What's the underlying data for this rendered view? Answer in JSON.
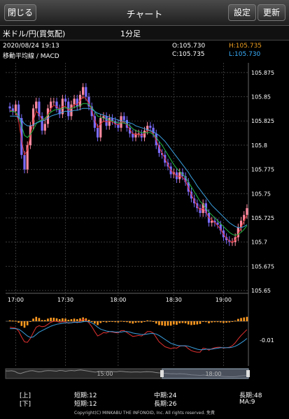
{
  "topbar": {
    "close_label": "閉じる",
    "title": "チャート",
    "settings_label": "設定",
    "refresh_label": "更新"
  },
  "instrument": {
    "name": "米ドル/円(買気配)",
    "timeframe": "1分足"
  },
  "info": {
    "datetime": "2020/08/24 19:13",
    "indicators": "移動平均線 / MACD",
    "open": "O:105.730",
    "high": "H:105.735",
    "close": "C:105.735",
    "low": "L:105.730"
  },
  "colors": {
    "bull": "#ff8aa0",
    "bear": "#7b6cff",
    "ma_short": "#e03030",
    "ma_mid": "#22bb44",
    "ma_long": "#3aa0e0",
    "high": "#f0a020",
    "low": "#3ab0ff",
    "hist": "#ff9a20"
  },
  "chart_data": {
    "type": "candlestick",
    "y_ticks": [
      "105.875",
      "105.85",
      "105.825",
      "105.8",
      "105.775",
      "105.75",
      "105.725",
      "105.7",
      "105.675",
      "105.65"
    ],
    "ylim": [
      105.65,
      105.885
    ],
    "x_ticks": [
      "17:00",
      "17:30",
      "18:00",
      "18:30",
      "19:00"
    ],
    "macd_label": "-0.01",
    "navigator_labels": [
      "15:00",
      "18:00"
    ],
    "candle_close": [
      105.838,
      105.835,
      105.842,
      105.828,
      105.79,
      105.775,
      105.8,
      105.82,
      105.838,
      105.845,
      105.83,
      105.815,
      105.822,
      105.838,
      105.845,
      105.845,
      105.838,
      105.832,
      105.848,
      105.845,
      105.83,
      105.842,
      105.848,
      105.84,
      105.852,
      105.86,
      105.85,
      105.84,
      105.83,
      105.818,
      105.808,
      105.828,
      105.83,
      105.82,
      105.828,
      105.825,
      105.822,
      105.818,
      105.83,
      105.826,
      105.818,
      105.812,
      105.808,
      105.812,
      105.812,
      105.808,
      105.815,
      105.82,
      105.818,
      105.812,
      105.8,
      105.792,
      105.79,
      105.782,
      105.778,
      105.77,
      105.772,
      105.765,
      105.772,
      105.768,
      105.762,
      105.752,
      105.745,
      105.74,
      105.735,
      105.73,
      105.74,
      105.73,
      105.72,
      105.722,
      105.72,
      105.718,
      105.712,
      105.705,
      105.702,
      105.7,
      105.7,
      105.705,
      105.715,
      105.722,
      105.728,
      105.735
    ],
    "ma_short": [
      105.836,
      105.835,
      105.834,
      105.825,
      105.805,
      105.79,
      105.795,
      105.81,
      105.825,
      105.835,
      105.832,
      105.826,
      105.826,
      105.832,
      105.838,
      105.841,
      105.84,
      105.837,
      105.84,
      105.84,
      105.836,
      105.838,
      105.842,
      105.842,
      105.846,
      105.85,
      105.848,
      105.843,
      105.836,
      105.826,
      105.818,
      105.822,
      105.825,
      105.824,
      105.825,
      105.824,
      105.822,
      105.821,
      105.824,
      105.824,
      105.821,
      105.816,
      105.812,
      105.811,
      105.811,
      105.81,
      105.812,
      105.815,
      105.815,
      105.812,
      105.805,
      105.798,
      105.792,
      105.786,
      105.78,
      105.774,
      105.771,
      105.768,
      105.768,
      105.767,
      105.763,
      105.756,
      105.749,
      105.743,
      105.737,
      105.733,
      105.735,
      105.731,
      105.725,
      105.723,
      105.72,
      105.717,
      105.713,
      105.708,
      105.704,
      105.701,
      105.7,
      105.702,
      105.708,
      105.715,
      105.722,
      105.728
    ],
    "ma_mid": [
      105.835,
      105.835,
      105.834,
      105.83,
      105.82,
      105.81,
      105.808,
      105.811,
      105.816,
      105.822,
      105.825,
      105.826,
      105.828,
      105.831,
      105.834,
      105.836,
      105.837,
      105.837,
      105.838,
      105.839,
      105.838,
      105.838,
      105.839,
      105.84,
      105.841,
      105.843,
      105.843,
      105.842,
      105.839,
      105.835,
      105.83,
      105.829,
      105.828,
      105.827,
      105.826,
      105.825,
      105.824,
      105.823,
      105.823,
      105.823,
      105.822,
      105.82,
      105.817,
      105.815,
      105.814,
      105.813,
      105.813,
      105.813,
      105.813,
      105.811,
      105.808,
      105.804,
      105.8,
      105.795,
      105.79,
      105.785,
      105.78,
      105.776,
      105.773,
      105.77,
      105.767,
      105.762,
      105.757,
      105.752,
      105.747,
      105.742,
      105.739,
      105.735,
      105.731,
      105.728,
      105.725,
      105.722,
      105.719,
      105.716,
      105.713,
      105.71,
      105.708,
      105.707,
      105.708,
      105.71,
      105.713,
      105.717
    ],
    "ma_long": [
      105.83,
      105.83,
      105.83,
      105.829,
      105.826,
      105.822,
      105.82,
      105.82,
      105.821,
      105.823,
      105.824,
      105.825,
      105.826,
      105.828,
      105.83,
      105.831,
      105.832,
      105.833,
      105.834,
      105.835,
      105.835,
      105.835,
      105.836,
      105.836,
      105.837,
      105.838,
      105.838,
      105.838,
      105.837,
      105.835,
      105.833,
      105.832,
      105.831,
      105.83,
      105.829,
      105.828,
      105.827,
      105.826,
      105.825,
      105.825,
      105.824,
      105.823,
      105.822,
      105.82,
      105.819,
      105.818,
      105.817,
      105.816,
      105.815,
      105.814,
      105.812,
      105.81,
      105.807,
      105.804,
      105.8,
      105.796,
      105.792,
      105.788,
      105.784,
      105.78,
      105.776,
      105.772,
      105.767,
      105.763,
      105.758,
      105.754,
      105.75,
      105.746,
      105.742,
      105.738,
      105.735,
      105.732,
      105.729,
      105.726,
      105.723,
      105.72,
      105.718,
      105.716,
      105.715,
      105.715,
      105.716,
      105.718
    ],
    "macd_hist": [
      0.3,
      0.2,
      0.1,
      -0.5,
      -1.6,
      -2.2,
      -1.4,
      -0.2,
      0.9,
      1.5,
      1.1,
      0.4,
      0.4,
      0.9,
      1.2,
      1.2,
      1.0,
      0.7,
      1.0,
      0.9,
      0.5,
      0.7,
      0.9,
      0.7,
      1.0,
      1.3,
      1.0,
      0.5,
      -0.1,
      -0.8,
      -1.3,
      -0.6,
      -0.2,
      -0.4,
      -0.1,
      -0.2,
      -0.3,
      -0.4,
      0.1,
      0.0,
      -0.3,
      -0.6,
      -0.8,
      -0.5,
      -0.4,
      -0.5,
      -0.1,
      0.3,
      0.2,
      -0.1,
      -0.8,
      -1.3,
      -1.4,
      -1.6,
      -1.5,
      -1.5,
      -1.1,
      -1.2,
      -0.7,
      -0.6,
      -0.7,
      -1.1,
      -1.3,
      -1.2,
      -1.1,
      -0.9,
      0.0,
      -0.3,
      -0.7,
      -0.4,
      -0.3,
      -0.3,
      -0.4,
      -0.6,
      -0.5,
      -0.4,
      -0.2,
      0.2,
      0.8,
      1.1,
      1.3,
      1.5
    ],
    "macd_line": [
      0.5,
      0.4,
      0.3,
      -0.3,
      -1.5,
      -2.5,
      -2.6,
      -1.8,
      -0.6,
      0.5,
      0.8,
      0.6,
      0.7,
      1.1,
      1.5,
      1.7,
      1.7,
      1.5,
      1.6,
      1.6,
      1.3,
      1.4,
      1.6,
      1.4,
      1.7,
      2.1,
      1.9,
      1.4,
      0.6,
      -0.4,
      -1.3,
      -1.0,
      -0.6,
      -0.7,
      -0.4,
      -0.5,
      -0.6,
      -0.7,
      -0.2,
      -0.2,
      -0.6,
      -1.0,
      -1.4,
      -1.3,
      -1.2,
      -1.3,
      -0.9,
      -0.4,
      -0.4,
      -0.7,
      -1.6,
      -2.5,
      -3.0,
      -3.5,
      -3.7,
      -3.9,
      -3.7,
      -3.8,
      -3.4,
      -3.3,
      -3.4,
      -3.9,
      -4.3,
      -4.5,
      -4.6,
      -4.6,
      -3.8,
      -3.9,
      -4.2,
      -3.9,
      -3.7,
      -3.6,
      -3.6,
      -3.8,
      -3.7,
      -3.6,
      -3.3,
      -2.7,
      -1.9,
      -1.2,
      -0.6,
      0.0
    ],
    "macd_signal": [
      0.2,
      0.2,
      0.2,
      0.1,
      -0.3,
      -0.8,
      -1.3,
      -1.6,
      -1.5,
      -1.0,
      -0.5,
      -0.2,
      0.1,
      0.4,
      0.7,
      0.9,
      1.1,
      1.2,
      1.3,
      1.4,
      1.4,
      1.4,
      1.5,
      1.5,
      1.5,
      1.6,
      1.7,
      1.6,
      1.4,
      1.0,
      0.5,
      0.1,
      -0.1,
      -0.3,
      -0.4,
      -0.4,
      -0.5,
      -0.5,
      -0.5,
      -0.4,
      -0.4,
      -0.5,
      -0.7,
      -0.8,
      -0.9,
      -1.0,
      -1.0,
      -0.9,
      -0.8,
      -0.8,
      -0.9,
      -1.2,
      -1.6,
      -2.0,
      -2.4,
      -2.8,
      -3.0,
      -3.2,
      -3.3,
      -3.3,
      -3.3,
      -3.4,
      -3.6,
      -3.8,
      -4.0,
      -4.1,
      -4.1,
      -4.0,
      -4.0,
      -4.0,
      -3.9,
      -3.8,
      -3.7,
      -3.7,
      -3.7,
      -3.7,
      -3.6,
      -3.4,
      -3.1,
      -2.7,
      -2.3,
      -1.8
    ]
  },
  "params": {
    "up_label": "[上]",
    "down_label": "[下]",
    "short_up": "短期:12",
    "mid_up": "中期:24",
    "long_up": "長期:48",
    "short_down": "短期:12",
    "long_down": "長期:26",
    "ma_down": "MA:9",
    "copyright": "Copyright(C) MINKABU THE INFONOID, Inc. All rights reserved. 免責"
  }
}
